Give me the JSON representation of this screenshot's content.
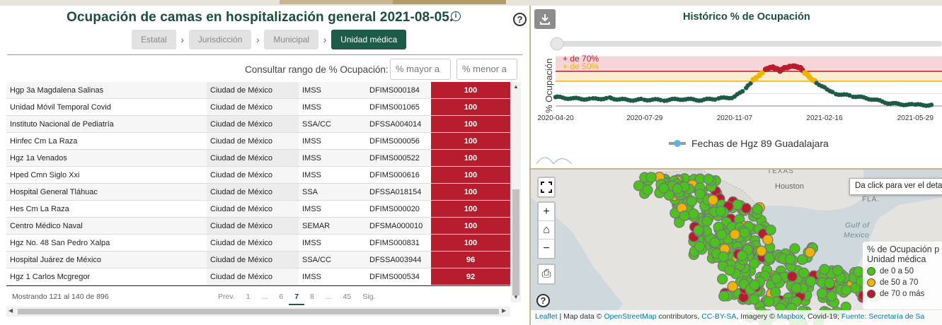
{
  "left": {
    "title": "Ocupación de camas en hospitalización general 2021-08-05.",
    "info_icon": "info-icon",
    "help_icon": "question-circle-icon",
    "breadcrumbs": [
      "Estatal",
      "Jurisdicción",
      "Municipal",
      "Unidad médica"
    ],
    "active_breadcrumb": "Unidad médica",
    "range_label": "Consultar rango de % Ocupación:",
    "range_min_placeholder": "% mayor a",
    "range_max_placeholder": "% menor a",
    "rows": [
      {
        "name": "Hgp 3a Magdalena Salinas",
        "city": "Ciudad de México",
        "inst": "IMSS",
        "clues": "DFIMS000184",
        "pct": "100"
      },
      {
        "name": "Unidad Móvil Temporal Covid",
        "city": "Ciudad de México",
        "inst": "IMSS",
        "clues": "DFIMS001065",
        "pct": "100"
      },
      {
        "name": "Instituto Nacional de Pediatría",
        "city": "Ciudad de México",
        "inst": "SSA/CC",
        "clues": "DFSSA004014",
        "pct": "100"
      },
      {
        "name": "Hinfec Cm La Raza",
        "city": "Ciudad de México",
        "inst": "IMSS",
        "clues": "DFIMS000056",
        "pct": "100"
      },
      {
        "name": "Hgz 1a Venados",
        "city": "Ciudad de México",
        "inst": "IMSS",
        "clues": "DFIMS000522",
        "pct": "100"
      },
      {
        "name": "Hped Cmn Siglo Xxi",
        "city": "Ciudad de México",
        "inst": "IMSS",
        "clues": "DFIMS000616",
        "pct": "100"
      },
      {
        "name": "Hospital General Tláhuac",
        "city": "Ciudad de México",
        "inst": "SSA",
        "clues": "DFSSA018154",
        "pct": "100"
      },
      {
        "name": "Hes Cm La Raza",
        "city": "Ciudad de México",
        "inst": "IMSS",
        "clues": "DFIMS000020",
        "pct": "100"
      },
      {
        "name": "Centro Médico Naval",
        "city": "Ciudad de México",
        "inst": "SEMAR",
        "clues": "DFSMA000010",
        "pct": "100"
      },
      {
        "name": "Hgz No. 48 San Pedro Xalpa",
        "city": "Ciudad de México",
        "inst": "IMSS",
        "clues": "DFIMS000831",
        "pct": "100"
      },
      {
        "name": "Hospital Juárez de México",
        "city": "Ciudad de México",
        "inst": "SSA/CC",
        "clues": "DFSSA003944",
        "pct": "96"
      },
      {
        "name": "Hgz 1 Carlos Mcgregor",
        "city": "Ciudad de México",
        "inst": "IMSS",
        "clues": "DFIMS000534",
        "pct": "92"
      }
    ],
    "showing": "Mostrando 121 al 140 de 896",
    "pager": [
      "Prev.",
      "1",
      "...",
      "6",
      "7",
      "8",
      "...",
      "45",
      "Sig."
    ],
    "current_page": "7"
  },
  "chart": {
    "title": "Histórico % de Ocupación",
    "download_icon": "download-icon",
    "legend": "Fechas de Hgz 89 Guadalajara",
    "accent": "#1d5a47",
    "threshold_colors": {
      "high": "#b81d2e",
      "mid": "#f0b400",
      "low": "#2e8b2e"
    }
  },
  "chart_data": {
    "type": "scatter",
    "title": "Histórico % de Ocupación",
    "xlabel": "",
    "ylabel": "% Ocupación",
    "x_ticks": [
      "2020-04-20",
      "2020-07-29",
      "2020-11-07",
      "2021-02-16",
      "2021-05-29"
    ],
    "reference_lines": [
      {
        "label": "+ de 70%",
        "value": 70
      },
      {
        "label": "+ de 50%",
        "value": 50
      }
    ],
    "ylim": [
      0,
      100
    ],
    "series": [
      {
        "name": "Fechas de Hgz 89 Guadalajara",
        "values": [
          {
            "x": "2020-04-20",
            "y": 18
          },
          {
            "x": "2020-05-10",
            "y": 15
          },
          {
            "x": "2020-06-01",
            "y": 14
          },
          {
            "x": "2020-06-20",
            "y": 16
          },
          {
            "x": "2020-07-10",
            "y": 12
          },
          {
            "x": "2020-07-29",
            "y": 13
          },
          {
            "x": "2020-08-20",
            "y": 12
          },
          {
            "x": "2020-09-10",
            "y": 14
          },
          {
            "x": "2020-10-01",
            "y": 12
          },
          {
            "x": "2020-10-20",
            "y": 15
          },
          {
            "x": "2020-11-07",
            "y": 18
          },
          {
            "x": "2020-11-20",
            "y": 35
          },
          {
            "x": "2020-11-28",
            "y": 52
          },
          {
            "x": "2020-12-05",
            "y": 62
          },
          {
            "x": "2020-12-12",
            "y": 75
          },
          {
            "x": "2020-12-20",
            "y": 80
          },
          {
            "x": "2020-12-28",
            "y": 72
          },
          {
            "x": "2021-01-05",
            "y": 78
          },
          {
            "x": "2021-01-12",
            "y": 80
          },
          {
            "x": "2021-01-20",
            "y": 76
          },
          {
            "x": "2021-01-28",
            "y": 62
          },
          {
            "x": "2021-02-05",
            "y": 50
          },
          {
            "x": "2021-02-16",
            "y": 38
          },
          {
            "x": "2021-03-01",
            "y": 25
          },
          {
            "x": "2021-03-20",
            "y": 20
          },
          {
            "x": "2021-04-10",
            "y": 14
          },
          {
            "x": "2021-05-01",
            "y": 5
          },
          {
            "x": "2021-05-29",
            "y": 2
          },
          {
            "x": "2021-06-20",
            "y": 2
          }
        ]
      }
    ]
  },
  "map": {
    "tooltip": "Da click para ver el deta",
    "labels": [
      "TEXAS",
      "Houston",
      "FLA.",
      "Gulf of",
      "Mexico"
    ],
    "legend_title": "% de Ocupación p",
    "legend_subtitle": "Unidad médica",
    "legend_items": [
      {
        "label": "de 0 a 50",
        "color": "#4cc21f"
      },
      {
        "label": "de 50 a 70",
        "color": "#f0b400"
      },
      {
        "label": "de 70 o más",
        "color": "#b81d2e"
      }
    ],
    "controls": [
      "fullscreen-icon",
      "zoom-in-icon",
      "home-icon",
      "zoom-out-icon",
      "print-icon"
    ],
    "attribution_parts": [
      "Leaflet",
      " | Map data © ",
      "OpenStreetMap",
      " contributors, ",
      "CC-BY-SA",
      ", Imagery © ",
      "Mapbox",
      ", Covid-19; ",
      "Fuente: Secretaría de Sa"
    ]
  }
}
